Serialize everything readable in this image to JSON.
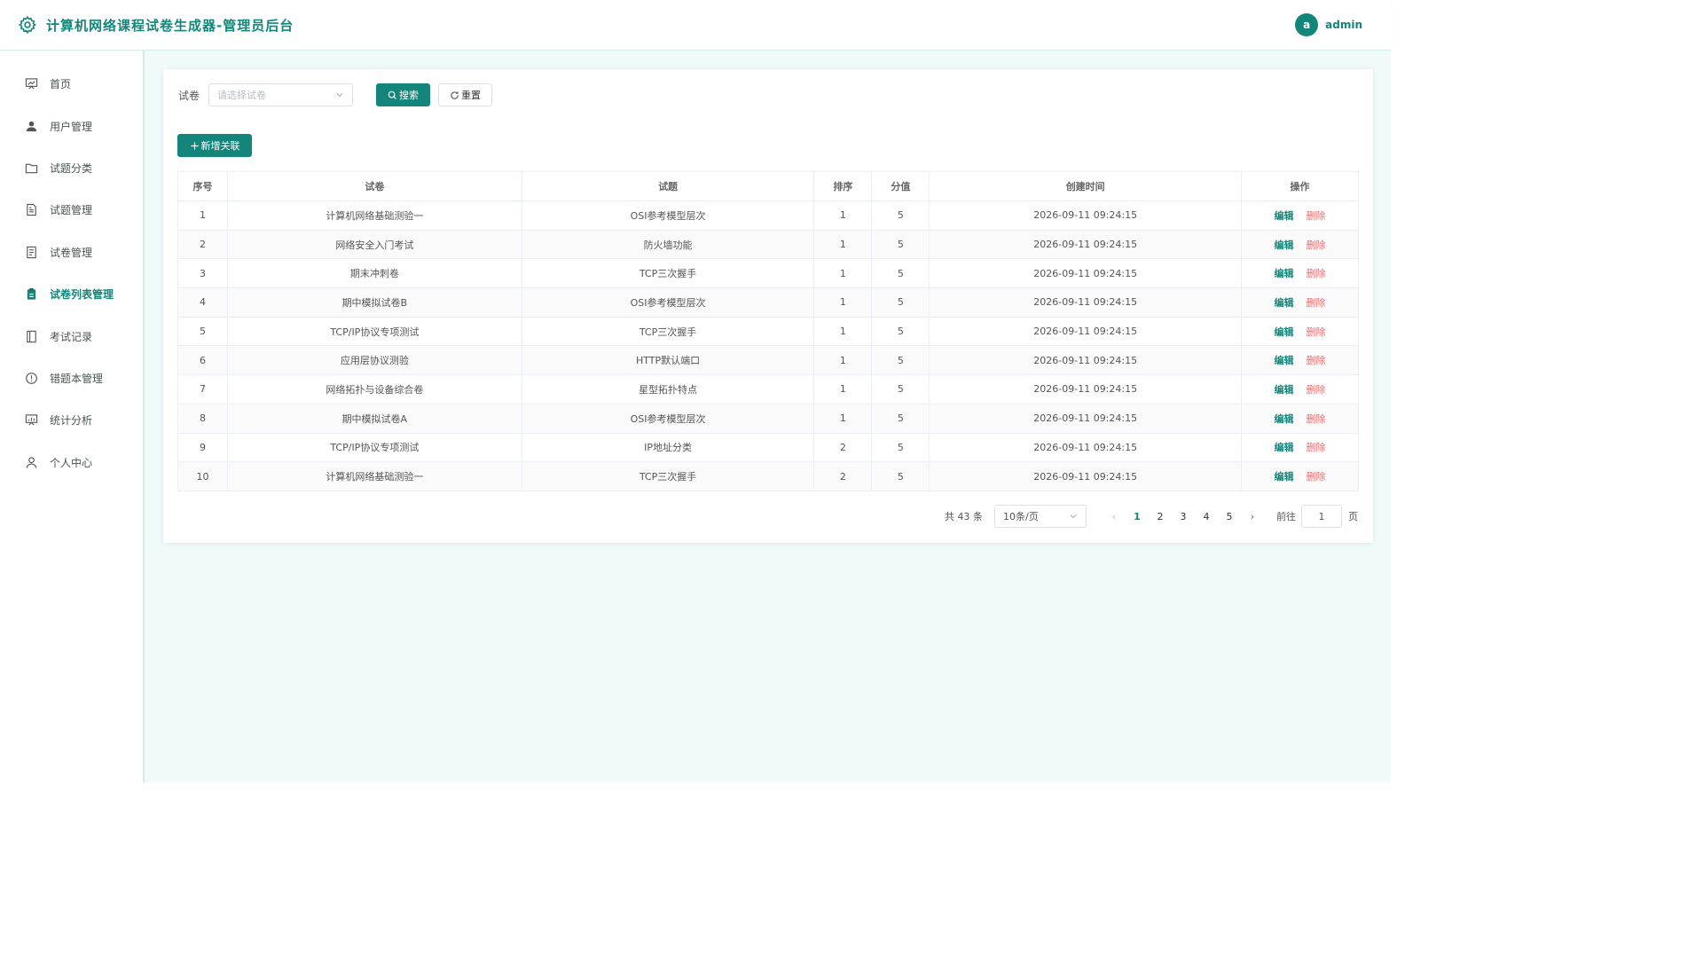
{
  "header": {
    "title": "计算机网络课程试卷生成器-管理员后台",
    "avatar_initial": "a",
    "username": "admin"
  },
  "sidebar": {
    "items": [
      {
        "label": "首页",
        "icon": "dashboard-icon"
      },
      {
        "label": "用户管理",
        "icon": "user-icon"
      },
      {
        "label": "试题分类",
        "icon": "folder-icon"
      },
      {
        "label": "试题管理",
        "icon": "document-icon"
      },
      {
        "label": "试卷管理",
        "icon": "tickets-icon"
      },
      {
        "label": "试卷列表管理",
        "icon": "clipboard-icon",
        "active": true
      },
      {
        "label": "考试记录",
        "icon": "notebook-icon"
      },
      {
        "label": "错题本管理",
        "icon": "warning-circle-icon"
      },
      {
        "label": "统计分析",
        "icon": "data-board-icon"
      },
      {
        "label": "个人中心",
        "icon": "user-outline-icon"
      }
    ]
  },
  "search": {
    "label": "试卷",
    "placeholder": "请选择试卷",
    "search_button": "搜索",
    "reset_button": "重置"
  },
  "add_button": "新增关联",
  "table": {
    "headers": [
      "序号",
      "试卷",
      "试题",
      "排序",
      "分值",
      "创建时间",
      "操作"
    ],
    "edit_label": "编辑",
    "delete_label": "删除",
    "rows": [
      [
        "1",
        "计算机网络基础测验一",
        "OSI参考模型层次",
        "1",
        "5",
        "2026-09-11 09:24:15"
      ],
      [
        "2",
        "网络安全入门考试",
        "防火墙功能",
        "1",
        "5",
        "2026-09-11 09:24:15"
      ],
      [
        "3",
        "期末冲刺卷",
        "TCP三次握手",
        "1",
        "5",
        "2026-09-11 09:24:15"
      ],
      [
        "4",
        "期中模拟试卷B",
        "OSI参考模型层次",
        "1",
        "5",
        "2026-09-11 09:24:15"
      ],
      [
        "5",
        "TCP/IP协议专项测试",
        "TCP三次握手",
        "1",
        "5",
        "2026-09-11 09:24:15"
      ],
      [
        "6",
        "应用层协议测验",
        "HTTP默认端口",
        "1",
        "5",
        "2026-09-11 09:24:15"
      ],
      [
        "7",
        "网络拓扑与设备综合卷",
        "星型拓扑特点",
        "1",
        "5",
        "2026-09-11 09:24:15"
      ],
      [
        "8",
        "期中模拟试卷A",
        "OSI参考模型层次",
        "1",
        "5",
        "2026-09-11 09:24:15"
      ],
      [
        "9",
        "TCP/IP协议专项测试",
        "IP地址分类",
        "2",
        "5",
        "2026-09-11 09:24:15"
      ],
      [
        "10",
        "计算机网络基础测验一",
        "TCP三次握手",
        "2",
        "5",
        "2026-09-11 09:24:15"
      ]
    ]
  },
  "pagination": {
    "total": "共 43 条",
    "page_size": "10条/页",
    "pages": [
      "1",
      "2",
      "3",
      "4",
      "5"
    ],
    "current_page": "1",
    "goto_label": "前往",
    "goto_value": "1",
    "page_suffix": "页"
  },
  "colors": {
    "accent": "#14857a",
    "danger": "#f56c6c",
    "main_bg": "#f0faf8"
  }
}
